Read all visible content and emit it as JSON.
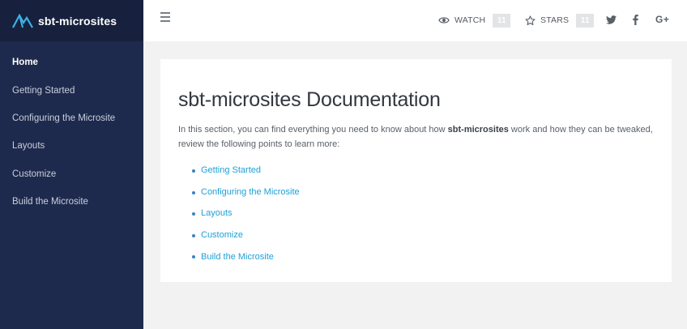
{
  "brand": {
    "name": "sbt-microsites",
    "logo_icon": "microsite-logo-icon",
    "logo_color": "#3bb2e5"
  },
  "sidebar": {
    "items": [
      {
        "label": "Home",
        "active": true
      },
      {
        "label": "Getting Started",
        "active": false
      },
      {
        "label": "Configuring the Microsite",
        "active": false
      },
      {
        "label": "Layouts",
        "active": false
      },
      {
        "label": "Customize",
        "active": false
      },
      {
        "label": "Build the Microsite",
        "active": false
      }
    ],
    "background": "#1e2a4d",
    "header_background": "#17213d"
  },
  "topbar": {
    "menu_icon": "hamburger-icon",
    "watch": {
      "label": "WATCH",
      "count": "11",
      "icon": "eye-icon"
    },
    "stars": {
      "label": "STARS",
      "count": "11",
      "icon": "star-icon"
    },
    "social": {
      "twitter_icon": "twitter-icon",
      "facebook_icon": "facebook-icon",
      "gplus_label": "G+"
    }
  },
  "main": {
    "title": "sbt-microsites Documentation",
    "intro_before": "In this section, you can find everything you need to know about how ",
    "intro_bold": "sbt-microsites",
    "intro_after": " work and how they can be tweaked, review the following points to learn more:",
    "links": [
      "Getting Started",
      "Configuring the Microsite",
      "Layouts",
      "Customize",
      "Build the Microsite"
    ],
    "link_color": "#1ea0d6"
  }
}
